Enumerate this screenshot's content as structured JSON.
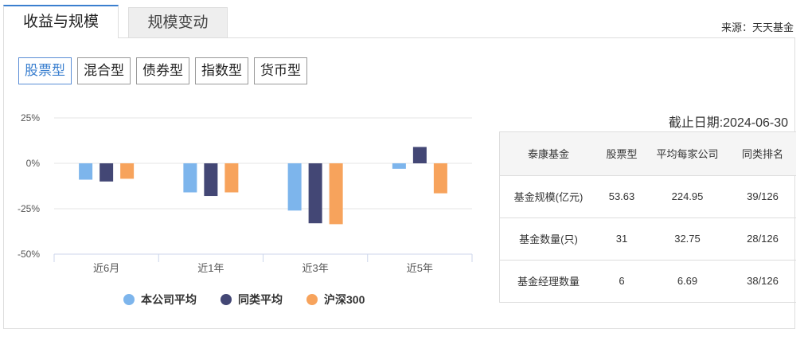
{
  "tabs": [
    {
      "label": "收益与规模",
      "active": true
    },
    {
      "label": "规模变动",
      "active": false
    }
  ],
  "source": "来源：天天基金",
  "filters": [
    {
      "label": "股票型",
      "active": true
    },
    {
      "label": "混合型",
      "active": false
    },
    {
      "label": "债券型",
      "active": false
    },
    {
      "label": "指数型",
      "active": false
    },
    {
      "label": "货币型",
      "active": false
    }
  ],
  "colors": {
    "accent": "#3a7fcf",
    "series1": "#7db5ec",
    "series2": "#434775",
    "series3": "#f7a35c"
  },
  "chart_data": {
    "type": "bar",
    "title": "",
    "xlabel": "",
    "ylabel": "",
    "categories": [
      "近6月",
      "近1年",
      "近3年",
      "近5年"
    ],
    "series": [
      {
        "name": "本公司平均",
        "color": "#7db5ec",
        "values": [
          -9,
          -16,
          -26,
          -3
        ]
      },
      {
        "name": "同类平均",
        "color": "#434775",
        "values": [
          -10,
          -18,
          -33,
          9
        ]
      },
      {
        "name": "沪深300",
        "color": "#f7a35c",
        "values": [
          -8.5,
          -16,
          -33.5,
          -16.5
        ]
      }
    ],
    "ylim": [
      -50,
      25
    ],
    "yticks": [
      25,
      0,
      -25,
      -50
    ],
    "ytick_labels": [
      "25%",
      "0%",
      "-25%",
      "-50%"
    ],
    "grid": true,
    "legend": "bottom"
  },
  "table": {
    "as_of": "截止日期:2024-06-30",
    "headers": [
      "泰康基金",
      "股票型",
      "平均每家公司",
      "同类排名"
    ],
    "rows": [
      [
        "基金规模(亿元)",
        "53.63",
        "224.95",
        "39/126"
      ],
      [
        "基金数量(只)",
        "31",
        "32.75",
        "28/126"
      ],
      [
        "基金经理数量",
        "6",
        "6.69",
        "38/126"
      ]
    ]
  }
}
